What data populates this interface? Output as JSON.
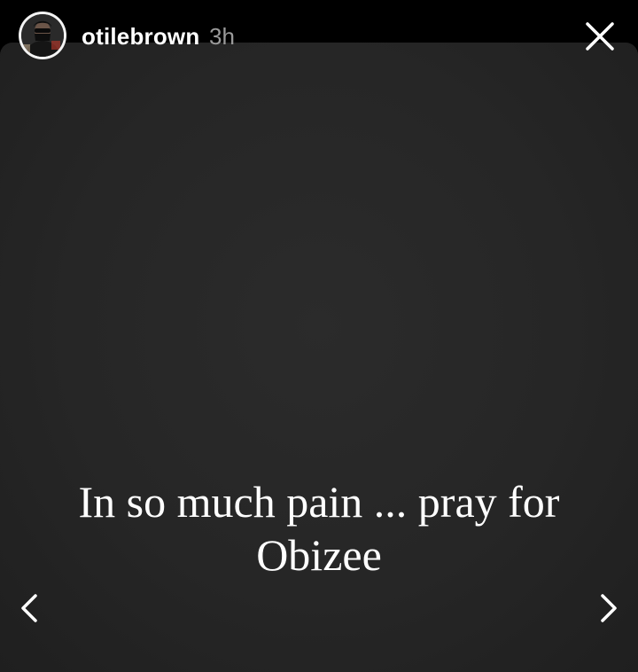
{
  "story": {
    "username": "otilebrown",
    "timestamp": "3h",
    "caption": "In so much pain ... pray for Obizee"
  },
  "icons": {
    "close": "close-icon",
    "previous": "chevron-left-icon",
    "next": "chevron-right-icon",
    "avatar": "profile-avatar"
  },
  "colors": {
    "background": "#000000",
    "story_background": "#262626",
    "text": "#ffffff",
    "timestamp": "#9a9a9a"
  }
}
